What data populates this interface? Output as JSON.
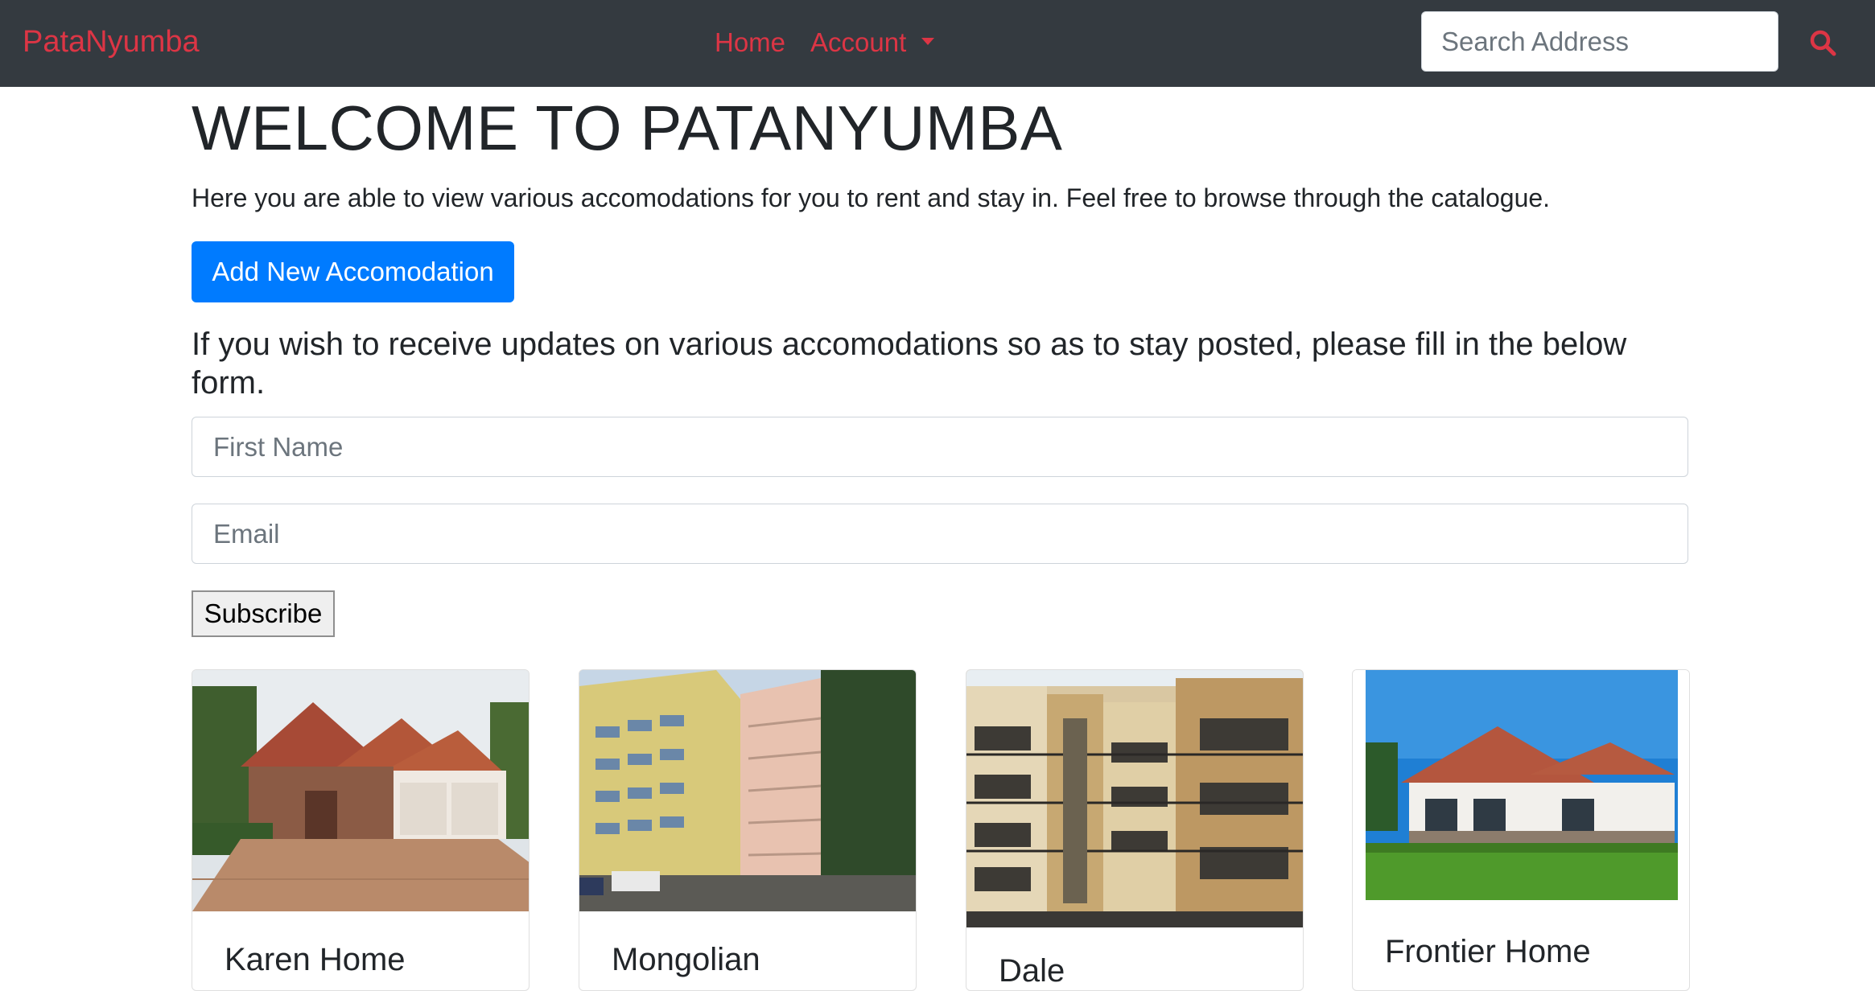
{
  "navbar": {
    "brand": "PataNyumba",
    "links": {
      "home": "Home",
      "account": "Account"
    },
    "search_placeholder": "Search Address"
  },
  "main": {
    "title": "WELCOME TO PATANYUMBA",
    "intro": "Here you are able to view various accomodations for you to rent and stay in. Feel free to browse through the catalogue.",
    "add_button": "Add New Accomodation",
    "form_heading": "If you wish to receive updates on various accomodations so as to stay posted, please fill in the below form.",
    "form": {
      "first_name_placeholder": "First Name",
      "email_placeholder": "Email",
      "subscribe_label": "Subscribe"
    }
  },
  "listings": [
    {
      "title": "Karen Home"
    },
    {
      "title": "Mongolian"
    },
    {
      "title": "Dale"
    },
    {
      "title": "Frontier Home"
    }
  ],
  "colors": {
    "navbar_bg": "#343a40",
    "brand": "#dc3545",
    "primary": "#007bff"
  },
  "icons": {
    "search": "search-icon",
    "dropdown": "caret-down-icon"
  }
}
